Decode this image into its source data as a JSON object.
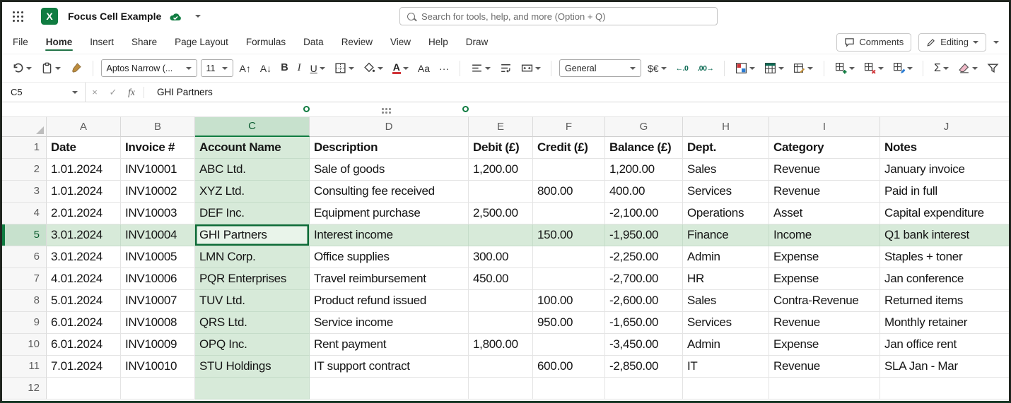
{
  "titlebar": {
    "title": "Focus Cell Example",
    "search_placeholder": "Search for tools, help, and more (Option + Q)"
  },
  "menubar": {
    "items": [
      "File",
      "Home",
      "Insert",
      "Share",
      "Page Layout",
      "Formulas",
      "Data",
      "Review",
      "View",
      "Help",
      "Draw"
    ],
    "active_item": "Home",
    "comments": "Comments",
    "editing": "Editing"
  },
  "toolbar": {
    "font_name": "Aptos Narrow (...",
    "font_size": "11",
    "number_format": "General"
  },
  "icons": {
    "bold": "B",
    "italic": "I",
    "underline": "U",
    "grow_font": "A↑",
    "shrink_font": "A↓",
    "font_color": "A",
    "character": "Aa",
    "more": "···",
    "currency": "$€",
    "decrease_decimal": "←.0",
    "increase_decimal": ".00→",
    "sum": "Σ",
    "cancel": "×",
    "confirm": "✓",
    "fx": "fx",
    "excel": "X"
  },
  "formula_bar": {
    "name_box": "C5",
    "value": "GHI Partners"
  },
  "grid": {
    "column_letters": [
      "A",
      "B",
      "C",
      "D",
      "E",
      "F",
      "G",
      "H",
      "I",
      "J"
    ],
    "selected": {
      "cell": "C5",
      "row": 5,
      "col_index": 2
    },
    "rows": [
      {
        "header": true,
        "cells": [
          "Date",
          "Invoice #",
          "Account Name",
          "Description",
          "Debit (£)",
          "Credit (£)",
          "Balance (£)",
          "Dept.",
          "Category",
          "Notes"
        ]
      },
      {
        "cells": [
          "1.01.2024",
          "INV10001",
          "ABC Ltd.",
          "Sale of goods",
          "1,200.00",
          "",
          "1,200.00",
          "Sales",
          "Revenue",
          "January invoice"
        ]
      },
      {
        "cells": [
          "1.01.2024",
          "INV10002",
          "XYZ Ltd.",
          "Consulting fee received",
          "",
          "800.00",
          "400.00",
          "Services",
          "Revenue",
          "Paid in full"
        ]
      },
      {
        "cells": [
          "2.01.2024",
          "INV10003",
          "DEF Inc.",
          "Equipment purchase",
          "2,500.00",
          "",
          "-2,100.00",
          "Operations",
          "Asset",
          "Capital expenditure"
        ]
      },
      {
        "cells": [
          "3.01.2024",
          "INV10004",
          "GHI Partners",
          "Interest income",
          "",
          "150.00",
          "-1,950.00",
          "Finance",
          "Income",
          "Q1 bank interest"
        ]
      },
      {
        "cells": [
          "3.01.2024",
          "INV10005",
          "LMN Corp.",
          "Office supplies",
          "300.00",
          "",
          "-2,250.00",
          "Admin",
          "Expense",
          "Staples + toner"
        ]
      },
      {
        "cells": [
          "4.01.2024",
          "INV10006",
          "PQR Enterprises",
          "Travel reimbursement",
          "450.00",
          "",
          "-2,700.00",
          "HR",
          "Expense",
          "Jan conference"
        ]
      },
      {
        "cells": [
          "5.01.2024",
          "INV10007",
          "TUV Ltd.",
          "Product refund issued",
          "",
          "100.00",
          "-2,600.00",
          "Sales",
          "Contra-Revenue",
          "Returned items"
        ]
      },
      {
        "cells": [
          "6.01.2024",
          "INV10008",
          "QRS Ltd.",
          "Service income",
          "",
          "950.00",
          "-1,650.00",
          "Services",
          "Revenue",
          "Monthly retainer"
        ]
      },
      {
        "cells": [
          "6.01.2024",
          "INV10009",
          "OPQ Inc.",
          "Rent payment",
          "1,800.00",
          "",
          "-3,450.00",
          "Admin",
          "Expense",
          "Jan office rent"
        ]
      },
      {
        "cells": [
          "7.01.2024",
          "INV10010",
          "STU Holdings",
          "IT support contract",
          "",
          "600.00",
          "-2,850.00",
          "IT",
          "Revenue",
          "SLA Jan - Mar"
        ]
      },
      {
        "cells": [
          "",
          "",
          "",
          "",
          "",
          "",
          "",
          "",
          "",
          ""
        ]
      }
    ]
  },
  "colors": {
    "accent_green": "#107C41",
    "highlight_green": "#D7EAD9",
    "active_cell_border": "#0D6B37",
    "font_color_bar": "#D13438"
  }
}
